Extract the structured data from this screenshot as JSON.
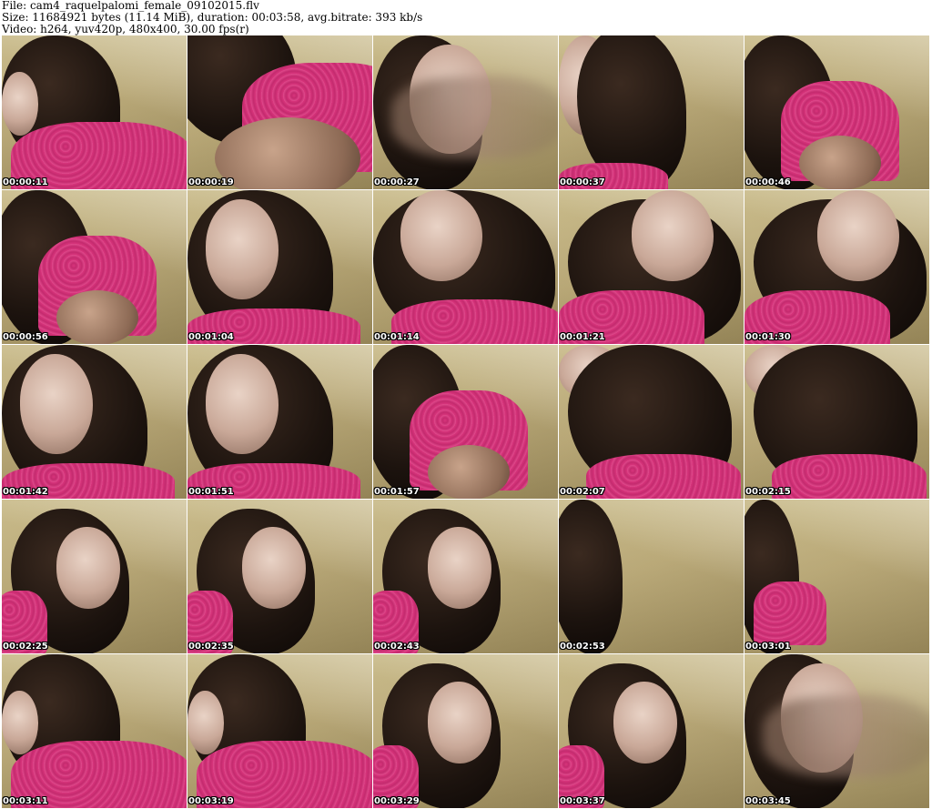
{
  "header": {
    "file_line": "File: cam4_raquelpalomi_female_09102015.flv",
    "size_line": "Size: 11684921 bytes (11.14 MiB), duration: 00:03:58, avg.bitrate: 393 kb/s",
    "video_line": "Video: h264, yuv420p, 480x400, 30.00 fps(r)"
  },
  "thumbnails": [
    {
      "timestamp": "00:00:11",
      "scene": "hair-shirt"
    },
    {
      "timestamp": "00:00:19",
      "scene": "shoulder"
    },
    {
      "timestamp": "00:00:27",
      "scene": "face-blur"
    },
    {
      "timestamp": "00:00:37",
      "scene": "face-side"
    },
    {
      "timestamp": "00:00:46",
      "scene": "shoulder-hair"
    },
    {
      "timestamp": "00:00:56",
      "scene": "shoulder-hair"
    },
    {
      "timestamp": "00:01:04",
      "scene": "face-left"
    },
    {
      "timestamp": "00:01:14",
      "scene": "face-center"
    },
    {
      "timestamp": "00:01:21",
      "scene": "face-tilt"
    },
    {
      "timestamp": "00:01:30",
      "scene": "face-tilt"
    },
    {
      "timestamp": "00:01:42",
      "scene": "face-left"
    },
    {
      "timestamp": "00:01:51",
      "scene": "face-left"
    },
    {
      "timestamp": "00:01:57",
      "scene": "shoulder-hair"
    },
    {
      "timestamp": "00:02:07",
      "scene": "face-top"
    },
    {
      "timestamp": "00:02:15",
      "scene": "face-top"
    },
    {
      "timestamp": "00:02:25",
      "scene": "face-right"
    },
    {
      "timestamp": "00:02:35",
      "scene": "face-right"
    },
    {
      "timestamp": "00:02:43",
      "scene": "face-right"
    },
    {
      "timestamp": "00:02:53",
      "scene": "hair-edge"
    },
    {
      "timestamp": "00:03:01",
      "scene": "hair-shirt-edge"
    },
    {
      "timestamp": "00:03:11",
      "scene": "hair-shirt"
    },
    {
      "timestamp": "00:03:19",
      "scene": "hair-shirt"
    },
    {
      "timestamp": "00:03:29",
      "scene": "face-right"
    },
    {
      "timestamp": "00:03:37",
      "scene": "face-right"
    },
    {
      "timestamp": "00:03:45",
      "scene": "face-blur"
    }
  ],
  "colors": {
    "background": "#ffffff",
    "header_text": "#000000",
    "timestamp_text": "#ffffff",
    "timestamp_outline": "#000000",
    "shirt": "#d8357c",
    "hair": "#1c130e",
    "wall": "#b7a675"
  }
}
